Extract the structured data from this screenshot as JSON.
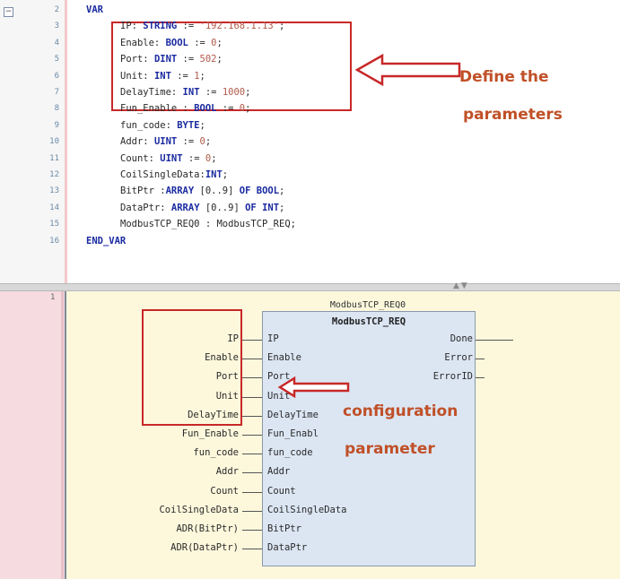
{
  "var_editor": {
    "fold_symbol": "⊟",
    "lines": [
      {
        "n": "2",
        "parts": [
          {
            "t": "VAR",
            "c": "kw"
          }
        ],
        "indent": 0
      },
      {
        "n": "3",
        "parts": [
          {
            "t": "IP: "
          },
          {
            "t": "STRING",
            "c": "kw"
          },
          {
            "t": " := "
          },
          {
            "t": "'192.168.1.13'",
            "c": "str"
          },
          {
            "t": ";"
          }
        ],
        "indent": 1
      },
      {
        "n": "4",
        "parts": [
          {
            "t": "Enable: "
          },
          {
            "t": "BOOL",
            "c": "kw"
          },
          {
            "t": " := "
          },
          {
            "t": "0",
            "c": "num"
          },
          {
            "t": ";"
          }
        ],
        "indent": 1
      },
      {
        "n": "5",
        "parts": [
          {
            "t": "Port: "
          },
          {
            "t": "DINT",
            "c": "kw"
          },
          {
            "t": " := "
          },
          {
            "t": "502",
            "c": "num"
          },
          {
            "t": ";"
          }
        ],
        "indent": 1
      },
      {
        "n": "6",
        "parts": [
          {
            "t": "Unit: "
          },
          {
            "t": "INT",
            "c": "kw"
          },
          {
            "t": " := "
          },
          {
            "t": "1",
            "c": "num"
          },
          {
            "t": ";"
          }
        ],
        "indent": 1
      },
      {
        "n": "7",
        "parts": [
          {
            "t": "DelayTime: "
          },
          {
            "t": "INT",
            "c": "kw"
          },
          {
            "t": " := "
          },
          {
            "t": "1000",
            "c": "num"
          },
          {
            "t": ";"
          }
        ],
        "indent": 1
      },
      {
        "n": "8",
        "parts": [
          {
            "t": "Fun_Enable : "
          },
          {
            "t": "BOOL",
            "c": "kw"
          },
          {
            "t": " := "
          },
          {
            "t": "0",
            "c": "num"
          },
          {
            "t": ";"
          }
        ],
        "indent": 1
      },
      {
        "n": "9",
        "parts": [
          {
            "t": "fun_code: "
          },
          {
            "t": "BYTE",
            "c": "kw"
          },
          {
            "t": ";"
          }
        ],
        "indent": 1
      },
      {
        "n": "10",
        "parts": [
          {
            "t": "Addr: "
          },
          {
            "t": "UINT",
            "c": "kw"
          },
          {
            "t": " := "
          },
          {
            "t": "0",
            "c": "num"
          },
          {
            "t": ";"
          }
        ],
        "indent": 1
      },
      {
        "n": "11",
        "parts": [
          {
            "t": "Count: "
          },
          {
            "t": "UINT",
            "c": "kw"
          },
          {
            "t": " := "
          },
          {
            "t": "0",
            "c": "num"
          },
          {
            "t": ";"
          }
        ],
        "indent": 1
      },
      {
        "n": "12",
        "parts": [
          {
            "t": "CoilSingleData:"
          },
          {
            "t": "INT",
            "c": "kw"
          },
          {
            "t": ";"
          }
        ],
        "indent": 1
      },
      {
        "n": "13",
        "parts": [
          {
            "t": "BitPtr :"
          },
          {
            "t": "ARRAY",
            "c": "kw"
          },
          {
            "t": " [0..9] "
          },
          {
            "t": "OF",
            "c": "kw"
          },
          {
            "t": " "
          },
          {
            "t": "BOOL",
            "c": "kw"
          },
          {
            "t": ";"
          }
        ],
        "indent": 1
      },
      {
        "n": "14",
        "parts": [
          {
            "t": "DataPtr: "
          },
          {
            "t": "ARRAY",
            "c": "kw"
          },
          {
            "t": " [0..9] "
          },
          {
            "t": "OF",
            "c": "kw"
          },
          {
            "t": " "
          },
          {
            "t": "INT",
            "c": "kw"
          },
          {
            "t": ";"
          }
        ],
        "indent": 1
      },
      {
        "n": "15",
        "parts": [
          {
            "t": "ModbusTCP_REQ0 : ModbusTCP_REQ;"
          }
        ],
        "indent": 1
      },
      {
        "n": "16",
        "parts": [
          {
            "t": "END_VAR",
            "c": "kw"
          }
        ],
        "indent": 0
      }
    ],
    "annotation": "Define the",
    "annotation_line2": "parameters"
  },
  "splitter": {
    "arrows": "▲▼"
  },
  "fbd": {
    "network_number": "1",
    "instance_name": "ModbusTCP_REQ0",
    "block_type": "ModbusTCP_REQ",
    "inputs": [
      {
        "pin": "IP",
        "actual": "IP"
      },
      {
        "pin": "Enable",
        "actual": "Enable"
      },
      {
        "pin": "Port",
        "actual": "Port"
      },
      {
        "pin": "Unit",
        "actual": "Unit"
      },
      {
        "pin": "DelayTime",
        "actual": "DelayTime"
      },
      {
        "pin": "Fun_Enabl",
        "actual": "Fun_Enable"
      },
      {
        "pin": "fun_code",
        "actual": "fun_code"
      },
      {
        "pin": "Addr",
        "actual": "Addr"
      },
      {
        "pin": "Count",
        "actual": "Count"
      },
      {
        "pin": "CoilSingleData",
        "actual": "CoilSingleData"
      },
      {
        "pin": "BitPtr",
        "actual": "ADR(BitPtr)"
      },
      {
        "pin": "DataPtr",
        "actual": "ADR(DataPtr)"
      }
    ],
    "outputs": [
      "Done",
      "Error",
      "ErrorID"
    ],
    "annotation_line1": "configuration",
    "annotation_line2": "parameter"
  },
  "colors": {
    "keyword": "#1a2aa0",
    "literal": "#b25a4a",
    "annotation_box": "#c82828",
    "annotation_text": "#c05028",
    "fb_fill": "#dce6f3",
    "fbd_background": "#fdf8dc"
  }
}
